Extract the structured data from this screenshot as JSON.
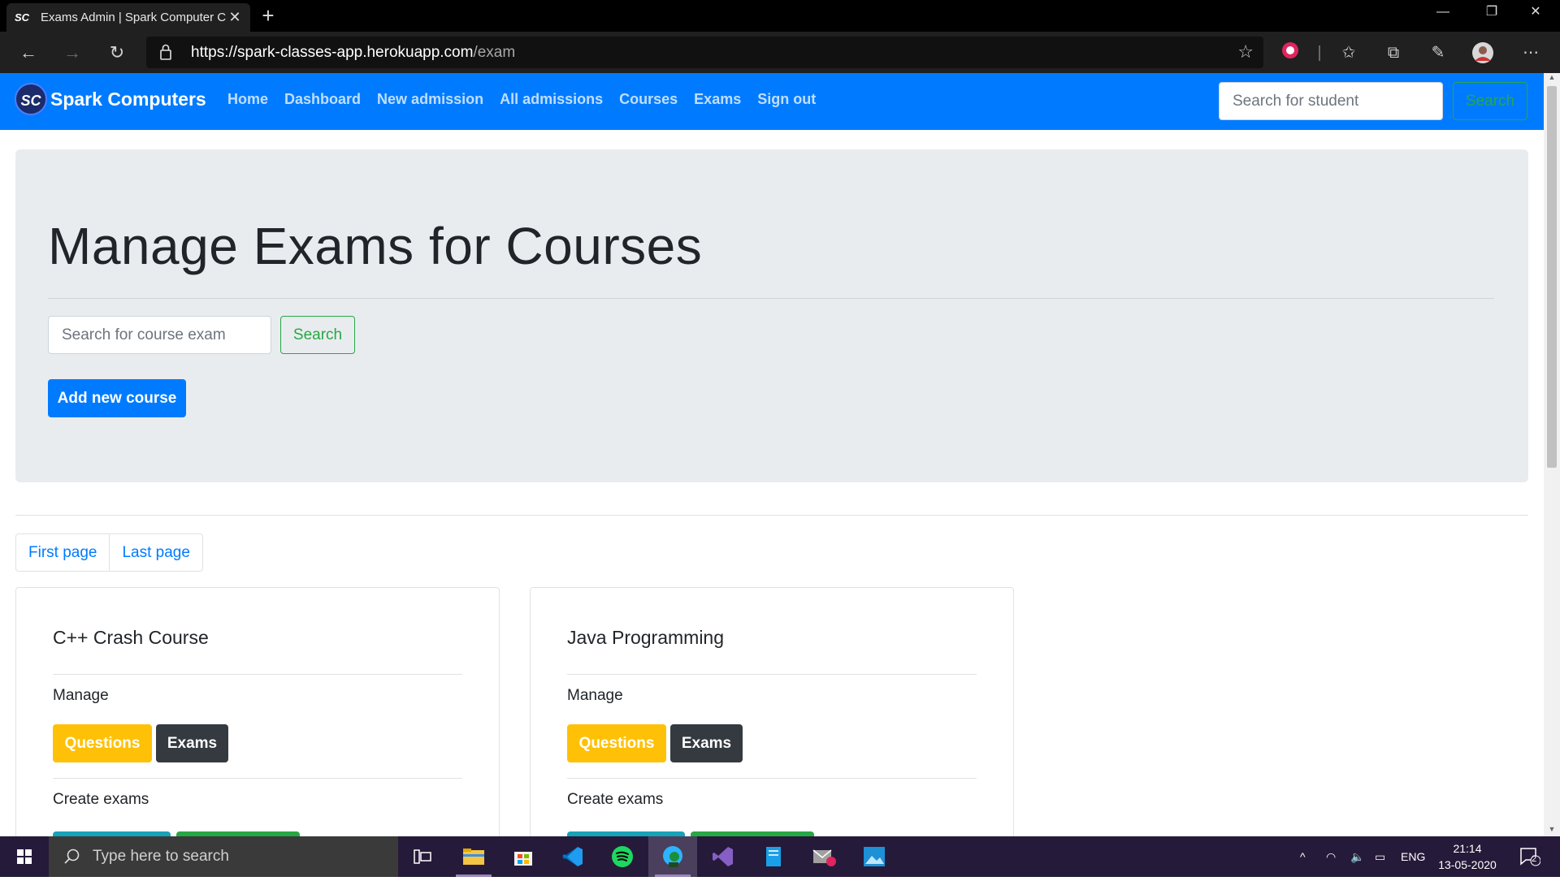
{
  "browser": {
    "tab_title": "Exams Admin | Spark Computer C",
    "tab_favicon": "SC",
    "url_host": "https://spark-classes-app.herokuapp.com",
    "url_path": "/exam"
  },
  "navbar": {
    "brand": "Spark Computers",
    "brand_logo": "SC",
    "links": [
      "Home",
      "Dashboard",
      "New admission",
      "All admissions",
      "Courses",
      "Exams",
      "Sign out"
    ],
    "search_placeholder": "Search for student",
    "search_button": "Search"
  },
  "jumbotron": {
    "title": "Manage Exams for Courses",
    "search_placeholder": "Search for course exam",
    "search_button": "Search",
    "add_button": "Add new course"
  },
  "pagination": {
    "first": "First page",
    "last": "Last page"
  },
  "courses": [
    {
      "title": "C++ Crash Course",
      "manage_label": "Manage",
      "questions_button": "Questions",
      "exams_button": "Exams",
      "create_label": "Create exams"
    },
    {
      "title": "Java Programming",
      "manage_label": "Manage",
      "questions_button": "Questions",
      "exams_button": "Exams",
      "create_label": "Create exams"
    }
  ],
  "taskbar": {
    "search_placeholder": "Type here to search",
    "language": "ENG",
    "time": "21:14",
    "date": "13-05-2020",
    "notification_count": "2",
    "apps": [
      "task-view-icon",
      "file-explorer-icon",
      "store-icon",
      "vscode-icon",
      "spotify-icon",
      "edge-dev-icon",
      "visual-studio-icon",
      "notepad-icon",
      "mail-icon",
      "photos-icon"
    ]
  },
  "colors": {
    "primary": "#007bff",
    "success": "#28a745",
    "warning": "#ffc107",
    "dark": "#343a40",
    "jumbotron": "#e9ecef"
  }
}
